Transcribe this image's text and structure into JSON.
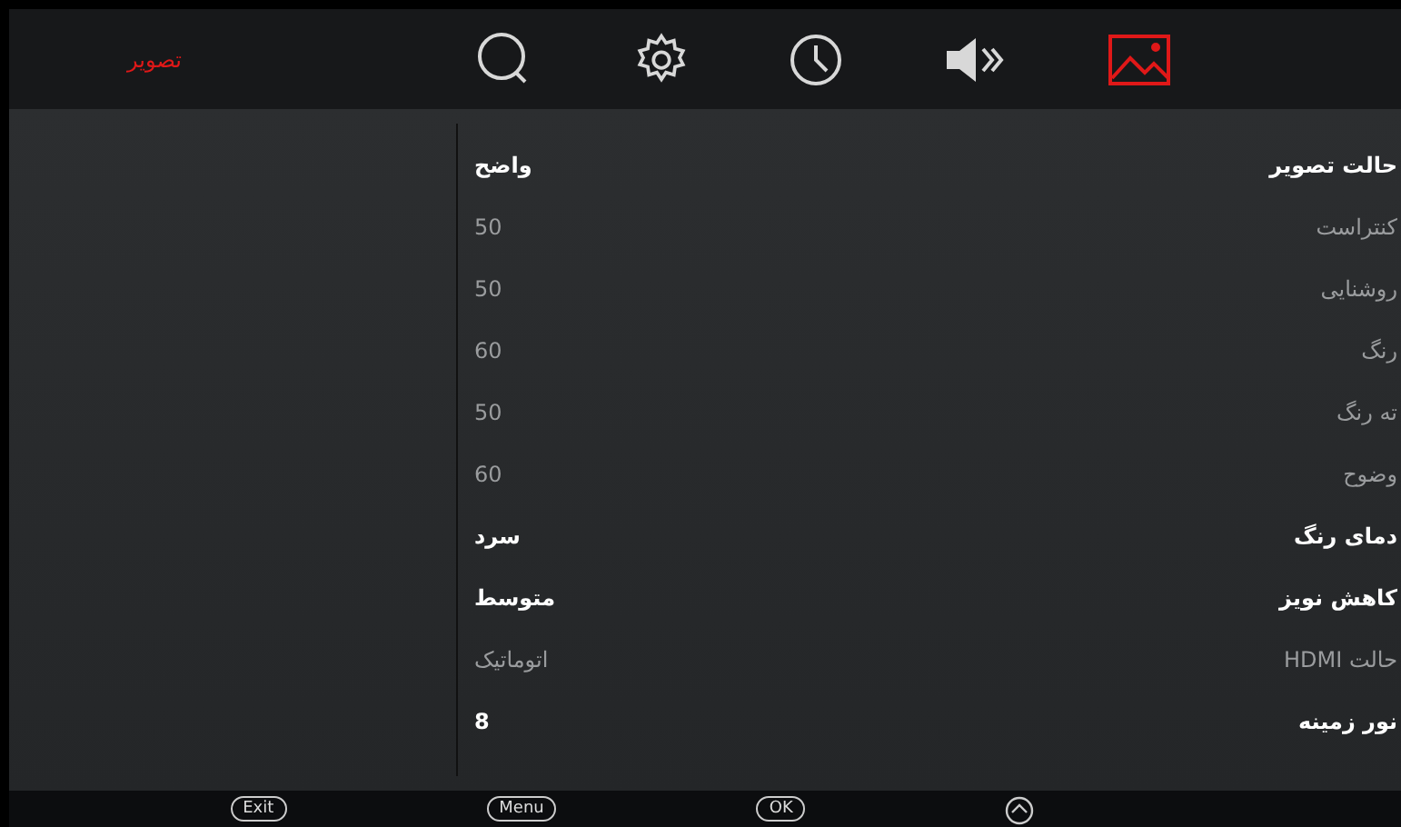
{
  "header": {
    "title": "تصویر"
  },
  "tabs": [
    {
      "kind": "search",
      "selected": false
    },
    {
      "kind": "settings",
      "selected": false
    },
    {
      "kind": "clock",
      "selected": false
    },
    {
      "kind": "sound",
      "selected": false
    },
    {
      "kind": "picture",
      "selected": true
    }
  ],
  "settings": [
    {
      "label": "حالت تصویر",
      "value": "واضح",
      "disabled": false
    },
    {
      "label": "کنتراست",
      "value": "50",
      "disabled": true
    },
    {
      "label": "روشنایی",
      "value": "50",
      "disabled": true
    },
    {
      "label": "رنگ",
      "value": "60",
      "disabled": true
    },
    {
      "label": "ته رنگ",
      "value": "50",
      "disabled": true
    },
    {
      "label": "وضوح",
      "value": "60",
      "disabled": true
    },
    {
      "label": "دمای رنگ",
      "value": "سرد",
      "disabled": false
    },
    {
      "label": "کاهش نویز",
      "value": "متوسط",
      "disabled": false
    },
    {
      "label": "حالت HDMI",
      "value": "اتوماتیک",
      "disabled": true
    },
    {
      "label": "نور زمینه",
      "value": "8",
      "disabled": false
    }
  ],
  "footer_keys": [
    {
      "kind": "nav"
    },
    {
      "kind": "key",
      "key": "OK"
    },
    {
      "kind": "key",
      "key": "Menu"
    },
    {
      "kind": "key",
      "key": "Exit"
    }
  ]
}
